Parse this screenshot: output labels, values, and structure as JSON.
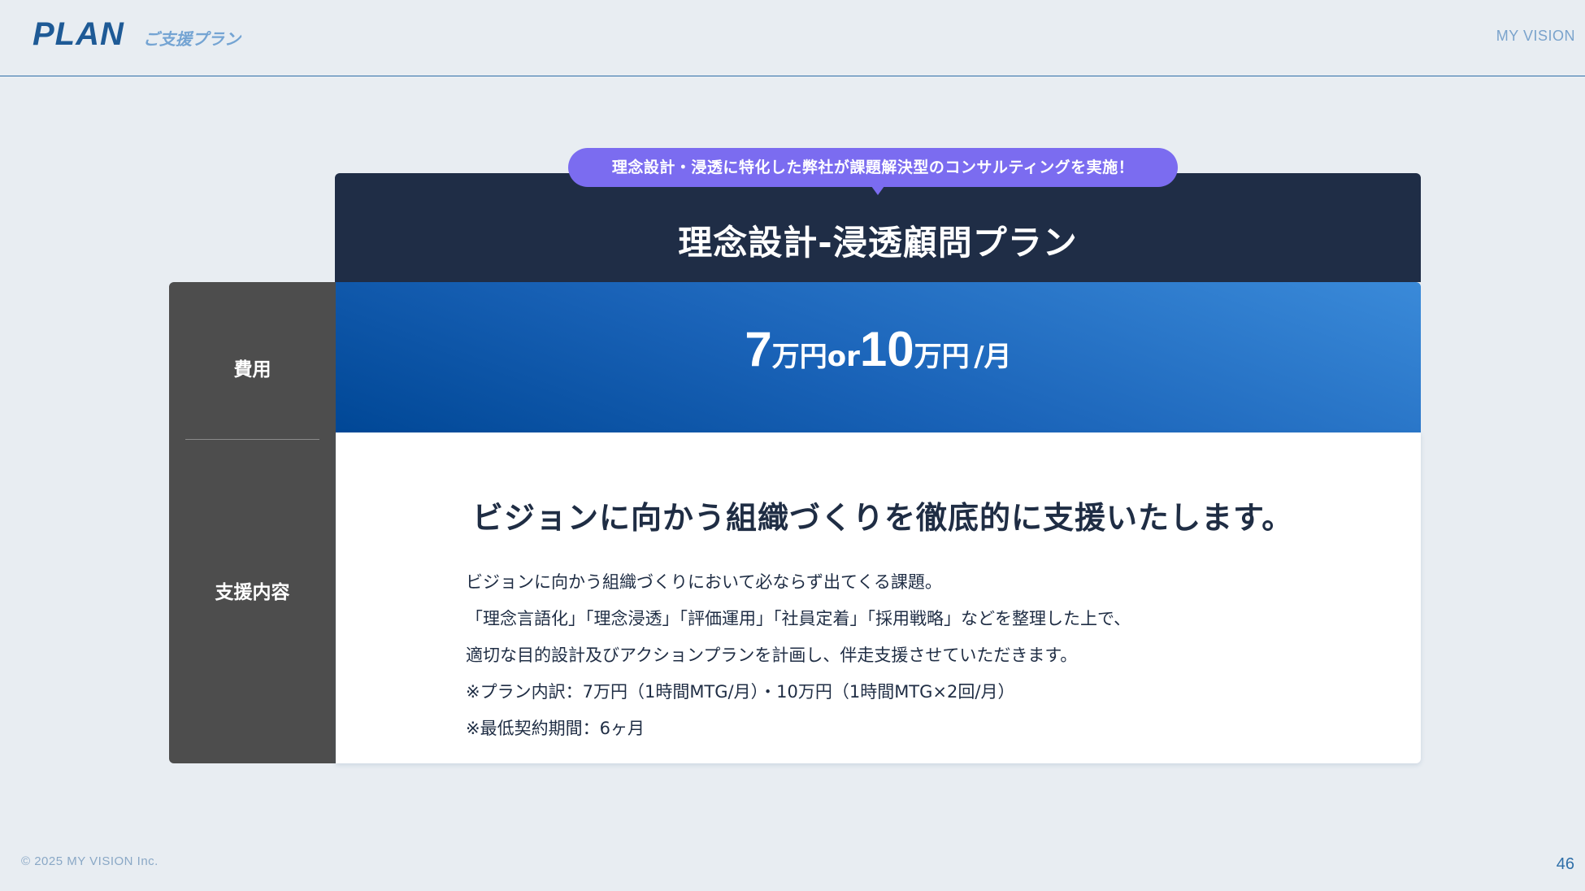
{
  "header": {
    "title": "PLAN",
    "subtitle": "ご支援プラン",
    "brand": "MY VISION"
  },
  "plan": {
    "bubble": "理念設計・浸透に特化した弊社が課題解決型のコンサルティングを実施！",
    "title": "理念設計-浸透顧問プラン",
    "labels": {
      "fee": "費用",
      "support": "支援内容"
    },
    "price": {
      "amount1": "7",
      "unit1": "万円",
      "connector": "or",
      "amount2": "10",
      "unit2": "万円",
      "period": "/月"
    },
    "headline": "ビジョンに向かう組織づくりを徹底的に支援いたします。",
    "body": [
      "ビジョンに向かう組織づくりにおいて必ならず出てくる課題。",
      "「理念言語化」「理念浸透」「評価運用」「社員定着」「採用戦略」などを整理した上で、",
      "適切な目的設計及びアクションプランを計画し、伴走支援させていただきます。",
      "※プラン内訳：7万円（1時間MTG/月）・10万円（1時間MTG×2回/月）",
      "※最低契約期間：6ヶ月"
    ]
  },
  "footer": {
    "copyright": "© 2025 MY VISION Inc.",
    "page_number": "46"
  },
  "colors": {
    "background": "#e8edf2",
    "accent_blue": "#1e5a96",
    "card_header": "#1f2d46",
    "label_column": "#4d4d4d",
    "bubble": "#7b6cf0",
    "price_gradient_start": "#004796",
    "price_gradient_end": "#3a8ad9"
  }
}
